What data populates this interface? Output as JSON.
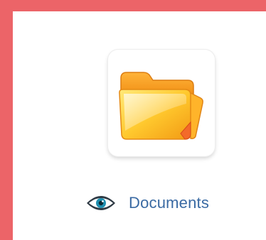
{
  "item": {
    "icon": "folder-icon",
    "preview_icon": "eye-icon",
    "label": "Documents"
  },
  "colors": {
    "background": "#ec6468",
    "panel": "#ffffff",
    "label": "#3a6aa3",
    "folder_front": "#ffd23a",
    "folder_back": "#f2a21a",
    "folder_edge": "#e07a14"
  }
}
